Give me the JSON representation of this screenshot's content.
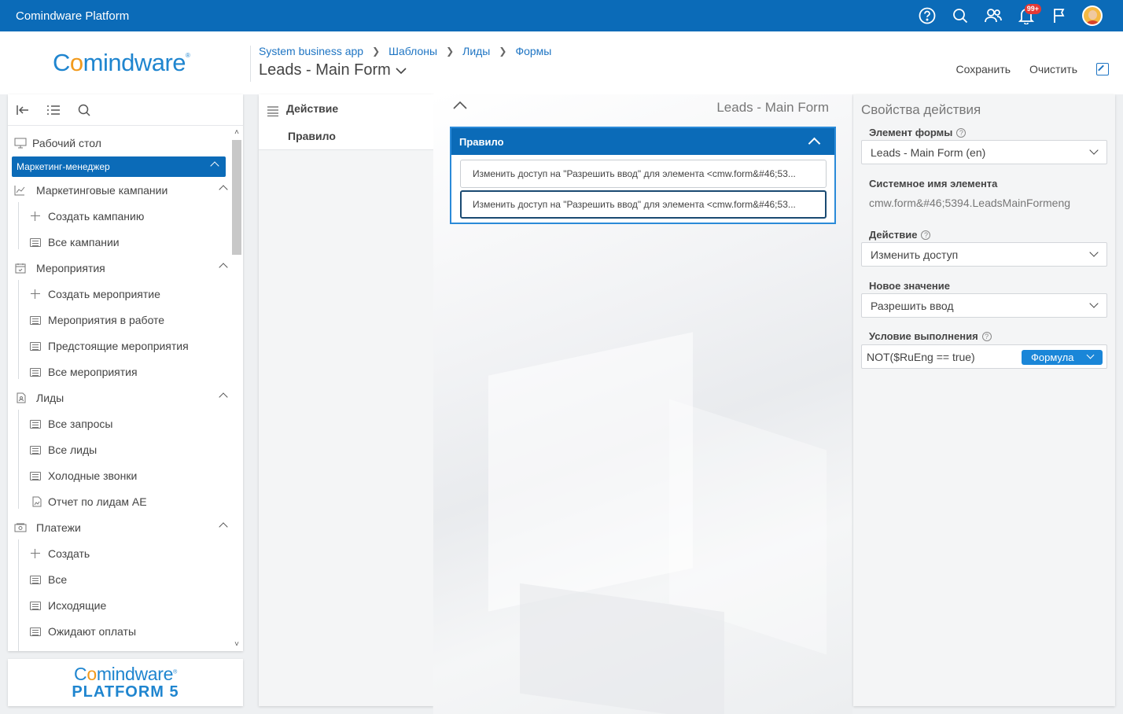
{
  "topbar": {
    "app_title": "Comindware Platform",
    "icons": [
      "help-icon",
      "search-icon",
      "users-icon",
      "bell-icon",
      "flag-icon",
      "avatar"
    ],
    "notification_badge": "99+"
  },
  "header": {
    "logo_text_pre": "C",
    "logo_text_o": "o",
    "logo_text_post": "mindware",
    "breadcrumb": [
      "System business app",
      "Шаблоны",
      "Лиды",
      "Формы"
    ],
    "page_title": "Leads - Main Form",
    "actions": {
      "save": "Сохранить",
      "clear": "Очистить"
    }
  },
  "leftnav": {
    "desktop": "Рабочий стол",
    "active_section": "Маркетинг-менеджер",
    "groups": [
      {
        "label": "Маркетинговые кампании",
        "icon": "chart-line-icon",
        "items": [
          {
            "label": "Создать кампанию",
            "icon": "plus-icon"
          },
          {
            "label": "Все кампании",
            "icon": "list-icon"
          }
        ]
      },
      {
        "label": "Мероприятия",
        "icon": "calendar-icon",
        "items": [
          {
            "label": "Создать мероприятие",
            "icon": "plus-icon"
          },
          {
            "label": "Мероприятия в работе",
            "icon": "list-icon"
          },
          {
            "label": "Предстоящие мероприятия",
            "icon": "list-icon"
          },
          {
            "label": "Все мероприятия",
            "icon": "list-icon"
          }
        ]
      },
      {
        "label": "Лиды",
        "icon": "lead-icon",
        "items": [
          {
            "label": "Все запросы",
            "icon": "list-icon"
          },
          {
            "label": "Все лиды",
            "icon": "list-icon"
          },
          {
            "label": "Холодные звонки",
            "icon": "list-icon"
          },
          {
            "label": "Отчет по лидам AE",
            "icon": "report-icon"
          }
        ]
      },
      {
        "label": "Платежи",
        "icon": "money-icon",
        "items": [
          {
            "label": "Создать",
            "icon": "plus-icon"
          },
          {
            "label": "Все",
            "icon": "list-icon"
          },
          {
            "label": "Исходящие",
            "icon": "list-icon"
          },
          {
            "label": "Ожидают оплаты",
            "icon": "list-icon"
          }
        ]
      }
    ]
  },
  "bottom_logo": {
    "line1_pre": "C",
    "line1_o": "o",
    "line1_post": "mindware",
    "line2": "PLATFORM 5"
  },
  "col2": {
    "header": "Действие",
    "item": "Правило"
  },
  "canvas": {
    "title": "Leads - Main Form",
    "rule": {
      "title": "Правило",
      "items": [
        "Изменить доступ на \"Разрешить ввод\" для элемента <cmw.form&#46;53...",
        "Изменить доступ на \"Разрешить ввод\" для элемента <cmw.form&#46;53..."
      ]
    }
  },
  "props": {
    "title": "Свойства действия",
    "form_element_label": "Элемент формы",
    "form_element_value": "Leads - Main Form (en)",
    "system_name_label": "Системное имя элемента",
    "system_name_value": "cmw.form&#46;5394.LeadsMainFormeng",
    "action_label": "Действие",
    "action_value": "Изменить доступ",
    "new_value_label": "Новое значение",
    "new_value_value": "Разрешить ввод",
    "condition_label": "Условие выполнения",
    "condition_value": "NOT($RuEng == true)",
    "formula_button": "Формула"
  }
}
